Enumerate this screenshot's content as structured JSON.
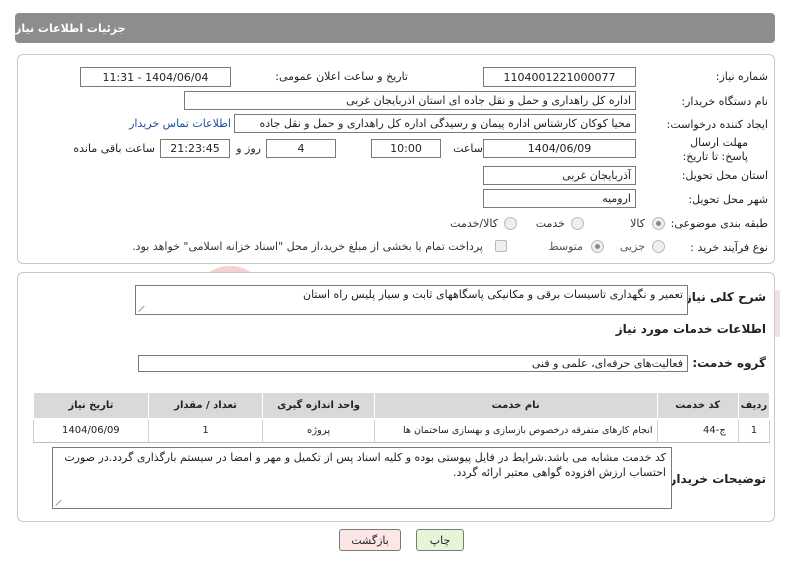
{
  "header": {
    "title": "جزئیات اطلاعات نیاز"
  },
  "form": {
    "need_number_label": "شماره نیاز:",
    "need_number": "1104001221000077",
    "announce_label": "تاریخ و ساعت اعلان عمومی:",
    "announce_value": "1404/06/04 - 11:31",
    "buyer_org_label": "نام دستگاه خریدار:",
    "buyer_org": "اداره کل راهداری و حمل و نقل جاده ای استان اذربایجان غربی",
    "requester_label": "ایجاد کننده درخواست:",
    "requester": "محیا کوکان کارشناس اداره پیمان و رسیدگی اداره کل راهداری و حمل و نقل جاده",
    "contact_link": "اطلاعات تماس خریدار",
    "deadline_label": "مهلت ارسال پاسخ: تا تاریخ:",
    "deadline_date": "1404/06/09",
    "time_label": "ساعت",
    "deadline_time": "10:00",
    "days_value": "4",
    "days_label": "روز و",
    "remaining_time": "21:23:45",
    "remaining_label": "ساعت باقی مانده",
    "province_label": "استان محل تحویل:",
    "province": "آذربایجان غربی",
    "city_label": "شهر محل تحویل:",
    "city": "ارومیه",
    "category_label": "طبقه بندی موضوعی:",
    "category_options": [
      "کالا",
      "خدمت",
      "کالا/خدمت"
    ],
    "process_label": "نوع فرآیند خرید :",
    "process_options": [
      "جزیی",
      "متوسط"
    ],
    "payment_note": "پرداخت تمام یا بخشی از مبلغ خرید،از محل \"اسناد خزانه اسلامی\" خواهد بود."
  },
  "description": {
    "label": "شرح کلی نیاز:",
    "text": "تعمیر و نگهداری تاسیسات برقی و مکانیکی پاسگاههای ثابت و سیار پلیس راه استان"
  },
  "services": {
    "section_title": "اطلاعات خدمات مورد نیاز",
    "group_label": "گروه خدمت:",
    "group_value": "فعالیت‌های حرفه‌ای، علمی و فنی",
    "columns": [
      "ردیف",
      "کد خدمت",
      "نام خدمت",
      "واحد اندازه گیری",
      "تعداد / مقدار",
      "تاریخ نیاز"
    ],
    "rows": [
      {
        "index": "1",
        "code": "ج-44",
        "name": "انجام کارهای متفرقه درخصوص بازسازی و بهسازی ساختمان ها",
        "unit": "پروژه",
        "qty": "1",
        "date": "1404/06/09"
      }
    ]
  },
  "buyer_notes": {
    "label": "توضیحات خریدار:",
    "text": "کد خدمت مشابه می باشد.شرایط در فایل پیوستی بوده و کلیه اسناد پس از تکمیل و مهر و امضا در سیستم بارگذاری گردد.در صورت احتساب ارزش افزوده گواهی معتبر ارائه گردد."
  },
  "buttons": {
    "print": "چاپ",
    "back": "بازگشت"
  },
  "colors": {
    "title_bar": "#8d8d8d",
    "link": "#1a4fa0",
    "print_btn": "#e4f5d8",
    "back_btn": "#fde6e6"
  }
}
